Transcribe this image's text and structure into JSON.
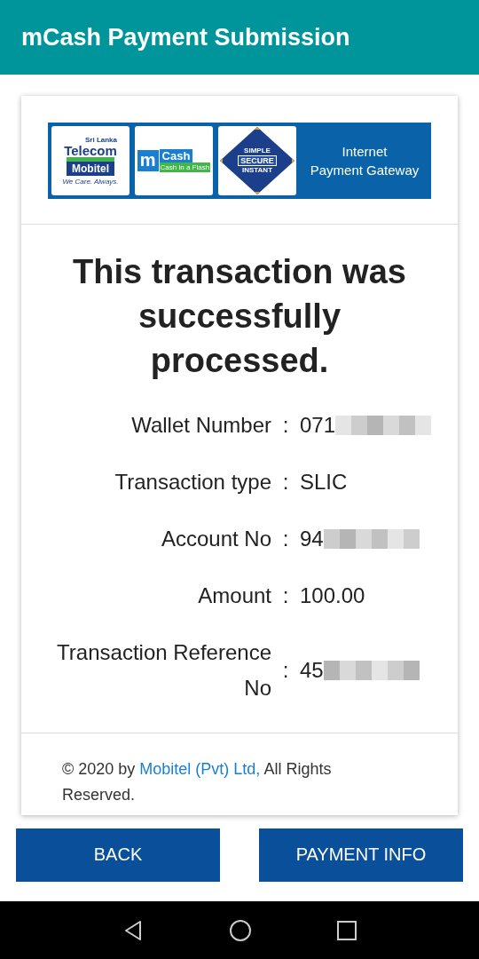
{
  "app_bar": {
    "title": "mCash Payment Submission"
  },
  "banner": {
    "telecom": {
      "top": "Sri Lanka",
      "name": "Telecom",
      "brand": "Mobitel",
      "tagline": "We Care. Always."
    },
    "mcash": {
      "letter": "m",
      "name": "Cash",
      "tagline": "Cash in a Flash"
    },
    "badge": [
      "SIMPLE",
      "SECURE",
      "INSTANT"
    ],
    "caption": [
      "Internet",
      "Payment Gateway"
    ]
  },
  "headline": "This transaction was successfully processed.",
  "details": [
    {
      "label": "Wallet Number",
      "separator": ":",
      "value": "071",
      "masked": true
    },
    {
      "label": "Transaction type",
      "separator": ":",
      "value": "SLIC",
      "masked": false
    },
    {
      "label": "Account No",
      "separator": ":",
      "value": "94",
      "masked": true
    },
    {
      "label": "Amount",
      "separator": ":",
      "value": "100.00",
      "masked": false
    },
    {
      "label": "Transaction Reference No",
      "separator": ":",
      "value": "45",
      "masked": true
    }
  ],
  "footer": {
    "before": "© 2020 by ",
    "link": "Mobitel (Pvt) Ltd,",
    "after": " All Rights Reserved."
  },
  "buttons": [
    "BACK",
    "PAYMENT INFO"
  ]
}
